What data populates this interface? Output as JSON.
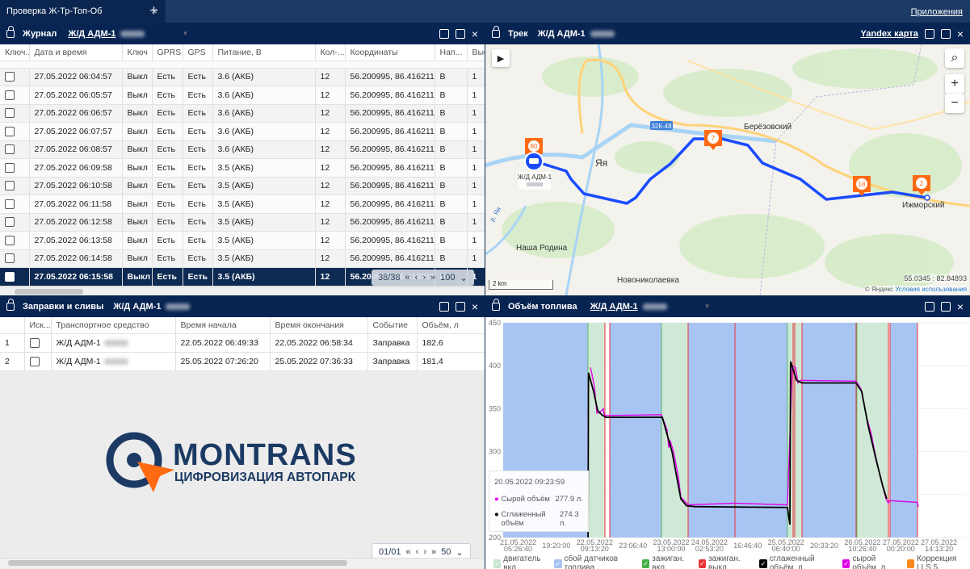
{
  "tabbar": {
    "tab_title": "Проверка Ж-Тр-Топ-Об",
    "apps": "Приложения"
  },
  "journal": {
    "title": "Журнал",
    "vehicle": "Ж/Д АДМ-1",
    "columns": [
      "Ключ... ▼",
      "Дата и время",
      "Ключ",
      "GPRS",
      "GPS",
      "Питание, В",
      "Кол-...",
      "Координаты",
      "Нап...",
      "Выс..."
    ],
    "rows": [
      [
        "",
        "27.05.2022 06:04:57",
        "Выкл",
        "Есть",
        "Есть",
        "3.6 (АКБ)",
        "12",
        "56.200995, 86.416211",
        "В",
        "1"
      ],
      [
        "",
        "27.05.2022 06:05:57",
        "Выкл",
        "Есть",
        "Есть",
        "3.6 (АКБ)",
        "12",
        "56.200995, 86.416211",
        "В",
        "1"
      ],
      [
        "",
        "27.05.2022 06:06:57",
        "Выкл",
        "Есть",
        "Есть",
        "3.6 (АКБ)",
        "12",
        "56.200995, 86.416211",
        "В",
        "1"
      ],
      [
        "",
        "27.05.2022 06:07:57",
        "Выкл",
        "Есть",
        "Есть",
        "3.6 (АКБ)",
        "12",
        "56.200995, 86.416211",
        "В",
        "1"
      ],
      [
        "",
        "27.05.2022 06:08:57",
        "Выкл",
        "Есть",
        "Есть",
        "3.6 (АКБ)",
        "12",
        "56.200995, 86.416211",
        "В",
        "1"
      ],
      [
        "",
        "27.05.2022 06:09:58",
        "Выкл",
        "Есть",
        "Есть",
        "3.5 (АКБ)",
        "12",
        "56.200995, 86.416211",
        "В",
        "1"
      ],
      [
        "",
        "27.05.2022 06:10:58",
        "Выкл",
        "Есть",
        "Есть",
        "3.5 (АКБ)",
        "12",
        "56.200995, 86.416211",
        "В",
        "1"
      ],
      [
        "",
        "27.05.2022 06:11:58",
        "Выкл",
        "Есть",
        "Есть",
        "3.5 (АКБ)",
        "12",
        "56.200995, 86.416211",
        "В",
        "1"
      ],
      [
        "",
        "27.05.2022 06:12:58",
        "Выкл",
        "Есть",
        "Есть",
        "3.5 (АКБ)",
        "12",
        "56.200995, 86.416211",
        "В",
        "1"
      ],
      [
        "",
        "27.05.2022 06:13:58",
        "Выкл",
        "Есть",
        "Есть",
        "3.5 (АКБ)",
        "12",
        "56.200995, 86.416211",
        "В",
        "1"
      ],
      [
        "",
        "27.05.2022 06:14:58",
        "Выкл",
        "Есть",
        "Есть",
        "3.5 (АКБ)",
        "12",
        "56.200995, 86.416211",
        "В",
        "1"
      ],
      [
        "",
        "27.05.2022 06:15:58",
        "Выкл",
        "Есть",
        "Есть",
        "3.5 (АКБ)",
        "12",
        "56.200995, 86.416211",
        "В",
        "1"
      ]
    ],
    "selected_row": 11,
    "pager": {
      "page": "38/38",
      "page_size": "100"
    }
  },
  "refuels": {
    "title": "Заправки и сливы",
    "vehicle": "Ж/Д АДМ-1",
    "columns": [
      "",
      "Иск...",
      "Транспортное средство",
      "Время начала",
      "Время окончания",
      "Событие",
      "Объём, л"
    ],
    "rows": [
      [
        "1",
        "",
        "Ж/Д АДМ-1",
        "22.05.2022 06:49:33",
        "22.05.2022 06:58:34",
        "Заправка",
        "182.6"
      ],
      [
        "2",
        "",
        "Ж/Д АДМ-1",
        "25.05.2022 07:26:20",
        "25.05.2022 07:36:33",
        "Заправка",
        "181.4"
      ]
    ],
    "pager": {
      "page": "01/01",
      "page_size": "50"
    }
  },
  "logo": {
    "name": "MONTRANS",
    "tagline": "ЦИФРОВИЗАЦИЯ АВТОПАРКА"
  },
  "map": {
    "title": "Трек",
    "vehicle": "Ж/Д АДМ-1",
    "provider": "Yandex карта",
    "places": [
      "Яя",
      "Берёзовский",
      "Наша Родина",
      "Новониколаевка",
      "Ижморский"
    ],
    "road": "32К-48",
    "river": "р. Яя",
    "vehicle_label": "Ж/Д АДМ-1",
    "markers": [
      "80",
      "7",
      "18",
      "2"
    ],
    "scale": "2 km",
    "coords": "55.0345 : 82.84893",
    "copyright": "© Яндекс",
    "terms": "Условия использования",
    "track_color": "#1a4cff",
    "marker_color": "#ff6a13"
  },
  "fuel": {
    "title": "Объём топлива",
    "vehicle": "Ж/Д АДМ-1",
    "tooltip": {
      "time": "20.05.2022  09:23:59",
      "raw_label": "Сырой объём",
      "raw_value": "277.9 л.",
      "smooth_label": "Сглаженный объём",
      "smooth_value": "274.3 л."
    },
    "legend": [
      {
        "label": "двигатель вкл.",
        "color": "#c8e6d0",
        "checked": true
      },
      {
        "label": "сбой датчиков топлива",
        "color": "#a8c4f2",
        "checked": true
      },
      {
        "label": "зажиган. вкл.",
        "color": "#43b047",
        "checked": true
      },
      {
        "label": "зажиган. выкл.",
        "color": "#e8343a",
        "checked": true
      },
      {
        "label": "сглаженный объём, л",
        "color": "#000000",
        "checked": true
      },
      {
        "label": "сырой объём, л",
        "color": "#e000e8",
        "checked": true
      },
      {
        "label": "Коррекция LLS 5",
        "color": "#ff8a1e",
        "checked": false
      }
    ]
  },
  "chart_data": {
    "type": "line",
    "xlim": [
      "2022-05-21T00:00",
      "2022-05-28T00:00"
    ],
    "ylim": [
      200,
      450
    ],
    "yticks": [
      200,
      250,
      300,
      350,
      400,
      450
    ],
    "grid": true,
    "xticks": [
      {
        "t": "2022-05-21T05:26:40",
        "l1": "21.05.2022",
        "l2": "05:26:40"
      },
      {
        "t": "2022-05-21T19:20:00",
        "l1": "19:20:00",
        "l2": ""
      },
      {
        "t": "2022-05-22T09:13:20",
        "l1": "22.05.2022",
        "l2": "09:13:20"
      },
      {
        "t": "2022-05-22T23:06:40",
        "l1": "23:06:40",
        "l2": ""
      },
      {
        "t": "2022-05-23T13:00:00",
        "l1": "23.05.2022",
        "l2": "13:00:00"
      },
      {
        "t": "2022-05-24T02:53:20",
        "l1": "24.05.2022",
        "l2": "02:53:20"
      },
      {
        "t": "2022-05-24T16:46:40",
        "l1": "16:46:40",
        "l2": ""
      },
      {
        "t": "2022-05-25T06:40:00",
        "l1": "25.05.2022",
        "l2": "06:40:00"
      },
      {
        "t": "2022-05-25T20:33:20",
        "l1": "20:33:20",
        "l2": ""
      },
      {
        "t": "2022-05-26T10:26:40",
        "l1": "26.05.2022",
        "l2": "10:26:40"
      },
      {
        "t": "2022-05-27T00:20:00",
        "l1": "27.05.2022",
        "l2": "00:20:00"
      },
      {
        "t": "2022-05-27T14:13:20",
        "l1": "27.05.2022",
        "l2": "14:13:20"
      }
    ],
    "bands": [
      {
        "kind": "сбой датчиков топлива",
        "from": "2022-05-21T00:00",
        "to": "2022-05-22T06:47"
      },
      {
        "kind": "двигатель вкл.",
        "from": "2022-05-22T06:47",
        "to": "2022-05-22T12:56"
      },
      {
        "kind": "сбой датчиков топлива",
        "from": "2022-05-22T14:42",
        "to": "2022-05-23T09:28"
      },
      {
        "kind": "двигатель вкл.",
        "from": "2022-05-23T09:28",
        "to": "2022-05-23T19:08"
      },
      {
        "kind": "сбой датчиков топлива",
        "from": "2022-05-23T19:08",
        "to": "2022-05-25T07:12"
      },
      {
        "kind": "двигатель вкл.",
        "from": "2022-05-25T07:12",
        "to": "2022-05-25T12:29"
      },
      {
        "kind": "сбой датчиков топлива",
        "from": "2022-05-25T12:29",
        "to": "2022-05-26T08:25"
      },
      {
        "kind": "двигатель вкл.",
        "from": "2022-05-26T08:25",
        "to": "2022-05-26T19:51"
      },
      {
        "kind": "сбой датчиков топлива",
        "from": "2022-05-26T20:26",
        "to": "2022-05-27T06:24"
      }
    ],
    "ignition_off": [
      "2022-05-22T12:56",
      "2022-05-22T14:42",
      "2022-05-23T19:08",
      "2022-05-24T12:09",
      "2022-05-25T09:15",
      "2022-05-25T09:50",
      "2022-05-25T12:29",
      "2022-05-26T08:07",
      "2022-05-26T19:51",
      "2022-05-26T20:26",
      "2022-05-27T06:24"
    ],
    "series": [
      {
        "name": "сглаженный объём, л",
        "color": "#000000",
        "points": [
          [
            "2022-05-22T06:49",
            200
          ],
          [
            "2022-05-22T06:58",
            392
          ],
          [
            "2022-05-22T08:50",
            370
          ],
          [
            "2022-05-22T10:18",
            348
          ],
          [
            "2022-05-22T11:46",
            343
          ],
          [
            "2022-05-22T13:14",
            340
          ],
          [
            "2022-05-23T09:46",
            340
          ],
          [
            "2022-05-23T11:31",
            320
          ],
          [
            "2022-05-23T13:17",
            300
          ],
          [
            "2022-05-23T15:02",
            270
          ],
          [
            "2022-05-23T16:30",
            245
          ],
          [
            "2022-05-23T18:33",
            237
          ],
          [
            "2022-05-23T21:29",
            236
          ],
          [
            "2022-05-25T07:12",
            235
          ],
          [
            "2022-05-25T08:05",
            215
          ],
          [
            "2022-05-25T08:20",
            405
          ],
          [
            "2022-05-25T09:20",
            395
          ],
          [
            "2022-05-25T10:30",
            383
          ],
          [
            "2022-05-25T12:30",
            380
          ],
          [
            "2022-05-26T08:07",
            380
          ],
          [
            "2022-05-26T10:10",
            370
          ],
          [
            "2022-05-26T12:30",
            330
          ],
          [
            "2022-05-26T15:26",
            290
          ],
          [
            "2022-05-26T17:47",
            260
          ],
          [
            "2022-05-26T19:15",
            245
          ]
        ]
      },
      {
        "name": "сырой объём, л",
        "color": "#e000e8",
        "points": [
          [
            "2022-05-22T07:40",
            398
          ],
          [
            "2022-05-22T08:15",
            390
          ],
          [
            "2022-05-22T09:08",
            375
          ],
          [
            "2022-05-22T10:01",
            345
          ],
          [
            "2022-05-22T10:53",
            345
          ],
          [
            "2022-05-22T12:21",
            350
          ],
          [
            "2022-05-22T12:39",
            342
          ],
          [
            "2022-05-23T09:28",
            343
          ],
          [
            "2022-05-23T11:31",
            325
          ],
          [
            "2022-05-23T12:06",
            305
          ],
          [
            "2022-05-23T12:41",
            312
          ],
          [
            "2022-05-23T13:52",
            300
          ],
          [
            "2022-05-23T15:37",
            270
          ],
          [
            "2022-05-23T16:30",
            247
          ],
          [
            "2022-05-23T19:08",
            238
          ],
          [
            "2022-05-24T12:09",
            240
          ],
          [
            "2022-05-25T07:12",
            238
          ],
          [
            "2022-05-25T08:58",
            400
          ],
          [
            "2022-05-25T10:08",
            398
          ],
          [
            "2022-05-25T11:01",
            380
          ],
          [
            "2022-05-25T11:53",
            383
          ],
          [
            "2022-05-26T08:07",
            382
          ],
          [
            "2022-05-26T09:53",
            373
          ],
          [
            "2022-05-26T11:56",
            340
          ],
          [
            "2022-05-26T13:41",
            320
          ],
          [
            "2022-05-26T14:52",
            300
          ],
          [
            "2022-05-26T16:55",
            270
          ],
          [
            "2022-05-26T18:58",
            245
          ],
          [
            "2022-05-26T19:51",
            240
          ],
          [
            "2022-05-26T20:08",
            243
          ],
          [
            "2022-05-27T06:24",
            241
          ],
          [
            "2022-05-27T06:42",
            236
          ]
        ]
      }
    ]
  }
}
